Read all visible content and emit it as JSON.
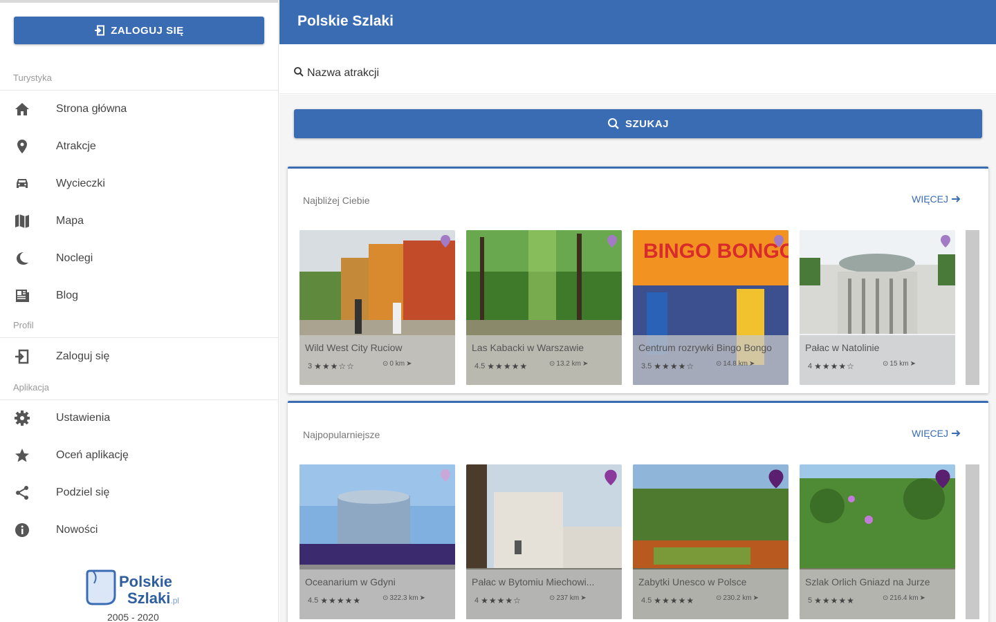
{
  "app": {
    "title": "Polskie Szlaki"
  },
  "sidebar": {
    "login_button": "ZALOGUJ SIĘ",
    "sections": [
      {
        "title": "Turystyka",
        "items": [
          {
            "label": "Strona główna",
            "icon": "home-icon"
          },
          {
            "label": "Atrakcje",
            "icon": "map-pin-icon"
          },
          {
            "label": "Wycieczki",
            "icon": "car-icon"
          },
          {
            "label": "Mapa",
            "icon": "map-icon"
          },
          {
            "label": "Noclegi",
            "icon": "moon-icon"
          },
          {
            "label": "Blog",
            "icon": "newspaper-icon"
          }
        ]
      },
      {
        "title": "Profil",
        "items": [
          {
            "label": "Zaloguj się",
            "icon": "login-icon"
          }
        ]
      },
      {
        "title": "Aplikacja",
        "items": [
          {
            "label": "Ustawienia",
            "icon": "gear-icon"
          },
          {
            "label": "Oceń aplikację",
            "icon": "star-icon"
          },
          {
            "label": "Podziel się",
            "icon": "share-icon"
          },
          {
            "label": "Nowości",
            "icon": "info-icon"
          }
        ]
      }
    ],
    "logo": {
      "line1": "Polskie",
      "line2": "Szlaki",
      "suffix": ".pl",
      "years": "2005 - 2020"
    }
  },
  "search": {
    "placeholder": "Nazwa atrakcji",
    "button": "SZUKAJ"
  },
  "panels": [
    {
      "title": "Najbliżej Ciebie",
      "more": "WIĘCEJ",
      "cards": [
        {
          "title": "Wild West City Ruciow",
          "rating": "3",
          "stars": "★★★☆☆",
          "distance": "0 km",
          "pin": "#a37bc4"
        },
        {
          "title": "Las Kabacki w Warszawie",
          "rating": "4.5",
          "stars": "★★★★★",
          "distance": "13.2 km",
          "pin": "#a37bc4"
        },
        {
          "title": "Centrum rozrywki Bingo Bongo",
          "rating": "3.5",
          "stars": "★★★★☆",
          "distance": "14.8 km",
          "pin": "#a37bc4"
        },
        {
          "title": "Pałac w Natolinie",
          "rating": "4",
          "stars": "★★★★☆",
          "distance": "15 km",
          "pin": "#a37bc4"
        }
      ]
    },
    {
      "title": "Najpopularniejsze",
      "more": "WIĘCEJ",
      "cards": [
        {
          "title": "Oceanarium w Gdyni",
          "rating": "4.5",
          "stars": "★★★★★",
          "distance": "322.3 km",
          "pin": "#c9a8d9"
        },
        {
          "title": "Pałac w Bytomiu Miechowi...",
          "rating": "4",
          "stars": "★★★★☆",
          "distance": "237 km",
          "pin": "#8b3a9c"
        },
        {
          "title": "Zabytki Unesco w Polsce",
          "rating": "4.5",
          "stars": "★★★★★",
          "distance": "230.2 km",
          "pin": "#5a1f6e"
        },
        {
          "title": "Szlak Orlich Gniazd na Jurze",
          "rating": "5",
          "stars": "★★★★★",
          "distance": "216.4 km",
          "pin": "#5a1f6e"
        }
      ]
    }
  ]
}
